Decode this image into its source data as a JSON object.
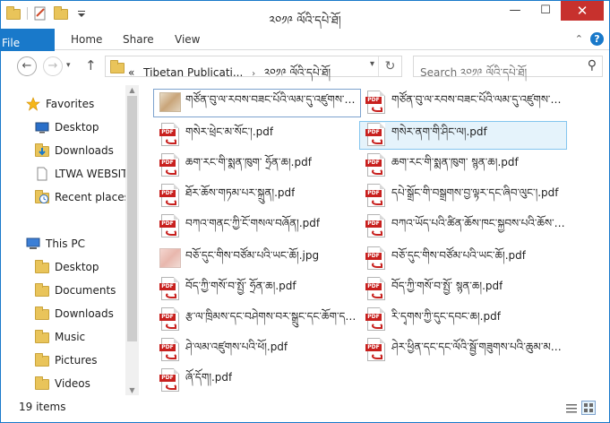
{
  "window": {
    "title": "༢༠༡༩ ལོའི་དཔེ་ཐོ།",
    "minimize_glyph": "—",
    "maximize_glyph": "☐",
    "close_glyph": "✕"
  },
  "ribbon": {
    "tabs": [
      {
        "label": "File"
      },
      {
        "label": "Home"
      },
      {
        "label": "Share"
      },
      {
        "label": "View"
      }
    ],
    "collapse_glyph": "⌃",
    "help_glyph": "?"
  },
  "navbar": {
    "back_glyph": "←",
    "forward_glyph": "→",
    "recent_glyph": "▾",
    "up_glyph": "↑",
    "breadcrumb_overflow": "«",
    "breadcrumbs": [
      "Tibetan Publicati...",
      "༢༠༡༩ ལོའི་དཔེ་ཐོ།"
    ],
    "separator_glyph": "›",
    "dropdown_glyph": "▾",
    "refresh_glyph": "↻",
    "search_placeholder": "Search ༢༠༡༩ ལོའི་དཔེ་ཐོ།",
    "search_glyph": "⚲"
  },
  "navpane": {
    "items": [
      {
        "label": "Favorites",
        "icon": "star-icon"
      },
      {
        "label": "Desktop",
        "icon": "desktop-icon"
      },
      {
        "label": "Downloads",
        "icon": "downloads-icon"
      },
      {
        "label": "LTWA WEBSITE",
        "icon": "file-icon"
      },
      {
        "label": "Recent places",
        "icon": "recent-places-icon"
      },
      {
        "label": "This PC",
        "icon": "computer-icon"
      },
      {
        "label": "Desktop",
        "icon": "folder-icon"
      },
      {
        "label": "Documents",
        "icon": "folder-icon"
      },
      {
        "label": "Downloads",
        "icon": "folder-icon"
      },
      {
        "label": "Music",
        "icon": "folder-icon"
      },
      {
        "label": "Pictures",
        "icon": "folder-icon"
      },
      {
        "label": "Videos",
        "icon": "folder-icon"
      }
    ]
  },
  "files": [
    {
      "name": "གཙོན་བུ་ལ་རབས་བཟང་པོའི་ལམ་དུ་འཛུགས་པའི་...",
      "type": "image"
    },
    {
      "name": "གཙོན་བུ་ལ་རབས་བཟང་པོའི་ལམ་དུ་འཛུགས་པའི་",
      "type": "pdf"
    },
    {
      "name": "གསེར་ཕྲེང་མ་སོང་།.pdf",
      "type": "pdf"
    },
    {
      "name": "གསེར་ནག་གི་ཤིང་ལ།.pdf",
      "type": "pdf"
    },
    {
      "name": "ཆག་རང་གི་སྨན་ཁུག་ ཧྲོན་ཆ།.pdf",
      "type": "pdf"
    },
    {
      "name": "ཆག་རང་གི་སྨན་ཁུག་ སྙན་ཆ།.pdf",
      "type": "pdf"
    },
    {
      "name": "ཐོར་ཆོས་གཏམ་པར་སྐྲུན།.pdf",
      "type": "pdf"
    },
    {
      "name": "དཔེ་སྒྲོང་གི་བསྒྲགས་བྱ་ལྟར་དང་ཞིབ་ལུང་།.pdf",
      "type": "pdf"
    },
    {
      "name": "བཀའ་གནང་ཀྱི་ངོ་གསལ་བཞོན།.pdf",
      "type": "pdf"
    },
    {
      "name": "བཀའ་ཡོད་པའི་ཚིན་ཆོས་ཁང་སྐྱབས་པའི་ཆོས་ཀྱི་རྣམ་...",
      "type": "pdf"
    },
    {
      "name": "བཅོ་དུང་གིས་བཙོམ་པའི་ཡང་ཆོ།.jpg",
      "type": "image-pink"
    },
    {
      "name": "བཅོ་དུང་གིས་བཙོམ་པའི་ཡང་ཆོ།.pdf",
      "type": "pdf"
    },
    {
      "name": "བོད་ཀྱི་གསོ་བ་སྤྱོ་ ཧྲོན་ཆ།.pdf",
      "type": "pdf"
    },
    {
      "name": "བོད་ཀྱི་གསོ་བ་སྤྱོ་ སྙན་ཆ།.pdf",
      "type": "pdf"
    },
    {
      "name": "རྩ་ལ་ཁྲིམས་དང་བཤེགས་བར་སྒྲུང་དང་ཆོག་དང་ལ་...",
      "type": "pdf"
    },
    {
      "name": "རི་དྭགས་ཀྱི་དུང་དབང་ཆ།.pdf",
      "type": "pdf"
    },
    {
      "name": "ཤེ་ལམ་འཛུགས་པའི་ཕོ།.pdf",
      "type": "pdf"
    },
    {
      "name": "ཤེར་ཕྱིན་དང་དང་ལོའི་སྦྱོ་གཟུགས་པའི་ཆུམ་མཆས།.pdf",
      "type": "pdf"
    },
    {
      "name": "ཞོ་དོག།.pdf",
      "type": "pdf"
    }
  ],
  "statusbar": {
    "item_count": "19 items"
  },
  "colors": {
    "accent": "#1979ca",
    "close": "#c7312d",
    "selection": "#e5f3fb",
    "pdf_red": "#c8201e",
    "folder": "#e9c45a"
  }
}
